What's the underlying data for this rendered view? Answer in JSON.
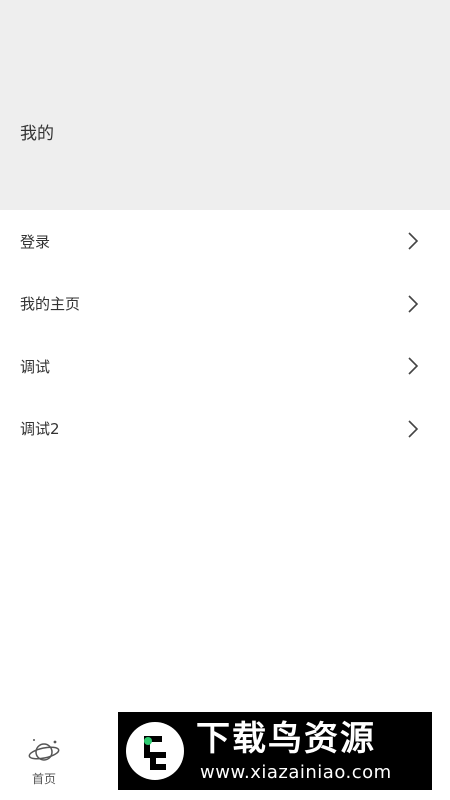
{
  "header": {
    "title": "我的"
  },
  "menu": {
    "items": [
      {
        "label": "登录"
      },
      {
        "label": "我的主页"
      },
      {
        "label": "调试"
      },
      {
        "label": "调试2"
      }
    ]
  },
  "tabbar": {
    "home_label": "首页",
    "home_icon": "planet-icon"
  },
  "watermark": {
    "title": "下载鸟资源",
    "url": "www.xiazainiao.com"
  },
  "colors": {
    "header_bg": "#eeeeee",
    "text": "#333333",
    "chevron": "#444444"
  }
}
